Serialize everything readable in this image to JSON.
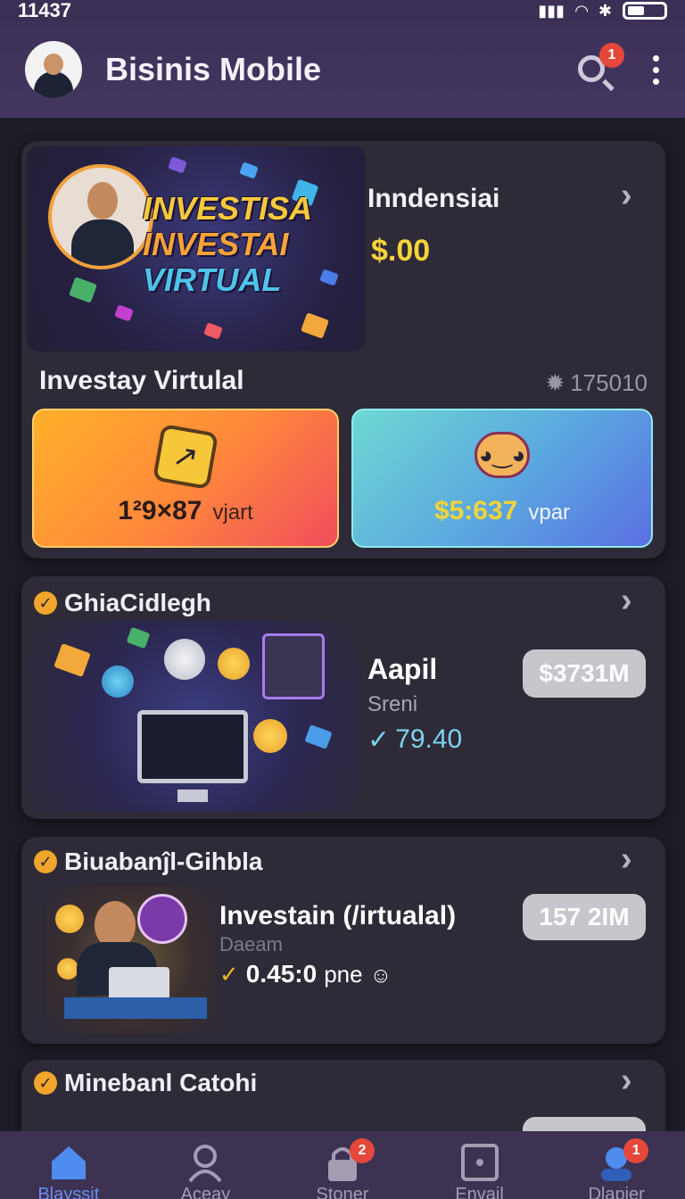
{
  "status_bar": {
    "time": "11437"
  },
  "header": {
    "title": "Bisinis Mobile",
    "notification_count": "1"
  },
  "hero_card": {
    "banner_lines": [
      "INVESTISA",
      "INVESTAI",
      "VIRTUAL"
    ],
    "title": "Inndensiai",
    "amount": "$.00",
    "section_label": "Investay Virtulal",
    "section_count": "175010",
    "tile_left": {
      "value": "1²9×87",
      "unit": "vjart"
    },
    "tile_right": {
      "value": "$5:637",
      "unit": "vpar"
    }
  },
  "card_2": {
    "title": "GhiaCidlegh",
    "name": "Aapil",
    "sub": "Sreni",
    "change": "79.40",
    "pill": "$3731M"
  },
  "card_3": {
    "title": "Biuabanĵl-Gihbla",
    "name": "Investain (/irtualal)",
    "sub": "Daeam",
    "change": "0.45:0",
    "change_suffix": "pne",
    "pill": "157 2IM"
  },
  "card_4": {
    "title": "Minebanl Catohi"
  },
  "bottom_nav": {
    "items": [
      {
        "label": "Blayssit"
      },
      {
        "label": "Aceay"
      },
      {
        "label": "Stoner",
        "badge": "2"
      },
      {
        "label": "Envail"
      },
      {
        "label": "Dlapier",
        "badge": "1"
      }
    ]
  },
  "colors": {
    "accent_yellow": "#f6d33a",
    "accent_blue": "#6a8df0",
    "badge_red": "#e5483a",
    "card_bg": "#2f2a37"
  }
}
